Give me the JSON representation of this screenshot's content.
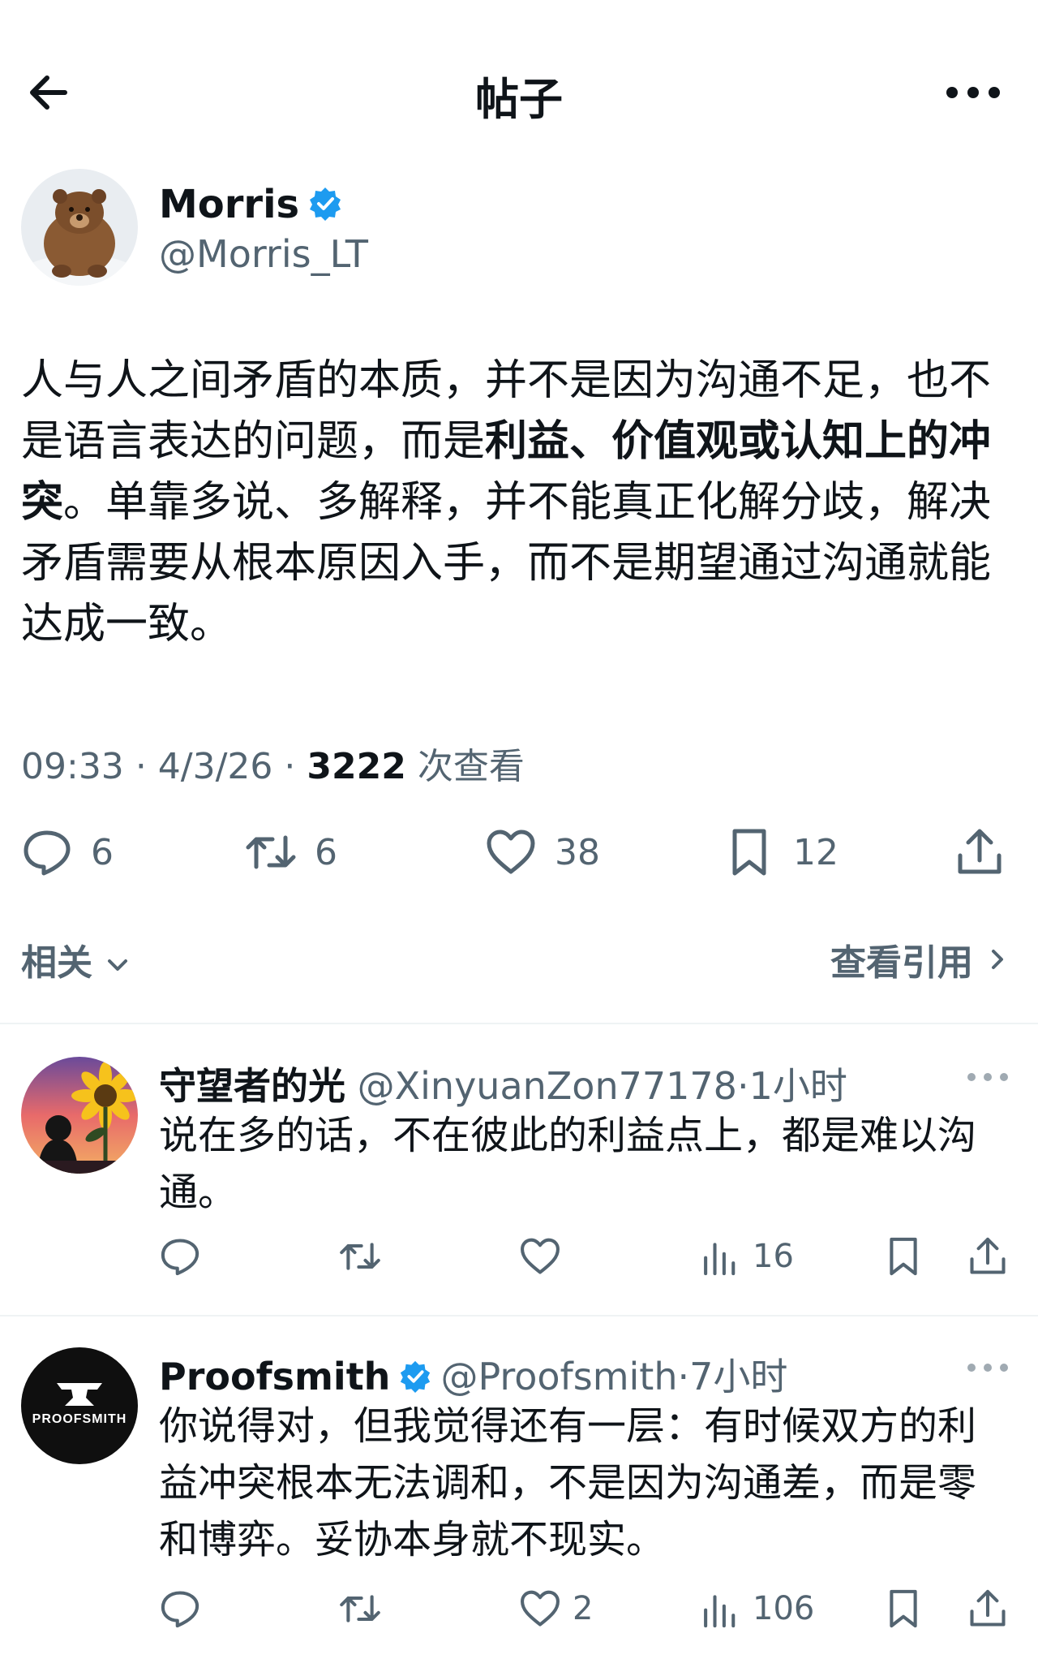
{
  "header": {
    "title": "帖子"
  },
  "post": {
    "author_name": "Morris",
    "author_handle": "@Morris_LT",
    "text_a": "人与人之间矛盾的本质，并不是因为沟通不足，也不是语言表达的问题，而是",
    "text_bold": "利益、价值观或认知上的冲突",
    "text_b": "。单靠多说、多解释，并不能真正化解分歧，解决矛盾需要从根本原因入手，而不是期望通过沟通就能达成一致。",
    "time": "09:33",
    "date": "4/3/26",
    "views": "3222",
    "views_label": "次查看",
    "replies": "6",
    "reposts": "6",
    "likes": "38",
    "bookmarks": "12"
  },
  "related": {
    "label": "相关",
    "quotes_label": "查看引用"
  },
  "replies": [
    {
      "name": "守望者的光",
      "handle": "@XinyuanZon77178",
      "time": "1小时",
      "text": "说在多的话，不在彼此的利益点上，都是难以沟通。",
      "views": "16"
    },
    {
      "name": "Proofsmith",
      "handle": "@Proofsmith",
      "time": "7小时",
      "text": "你说得对，但我觉得还有一层：有时候双方的利益冲突根本无法调和，不是因为沟通差，而是零和博弈。妥协本身就不现实。",
      "likes": "2",
      "views": "106",
      "avatar_text": "PROOFSMITH"
    }
  ],
  "colors": {
    "accent": "#1d9bf0",
    "text": "#0f1419",
    "muted": "#536471",
    "divider": "#eff3f4"
  },
  "icons": [
    "back-arrow-icon",
    "more-icon",
    "verified-badge-icon",
    "reply-icon",
    "repost-icon",
    "like-icon",
    "bookmark-icon",
    "share-icon",
    "views-icon",
    "chevron-down-icon",
    "chevron-right-icon"
  ]
}
